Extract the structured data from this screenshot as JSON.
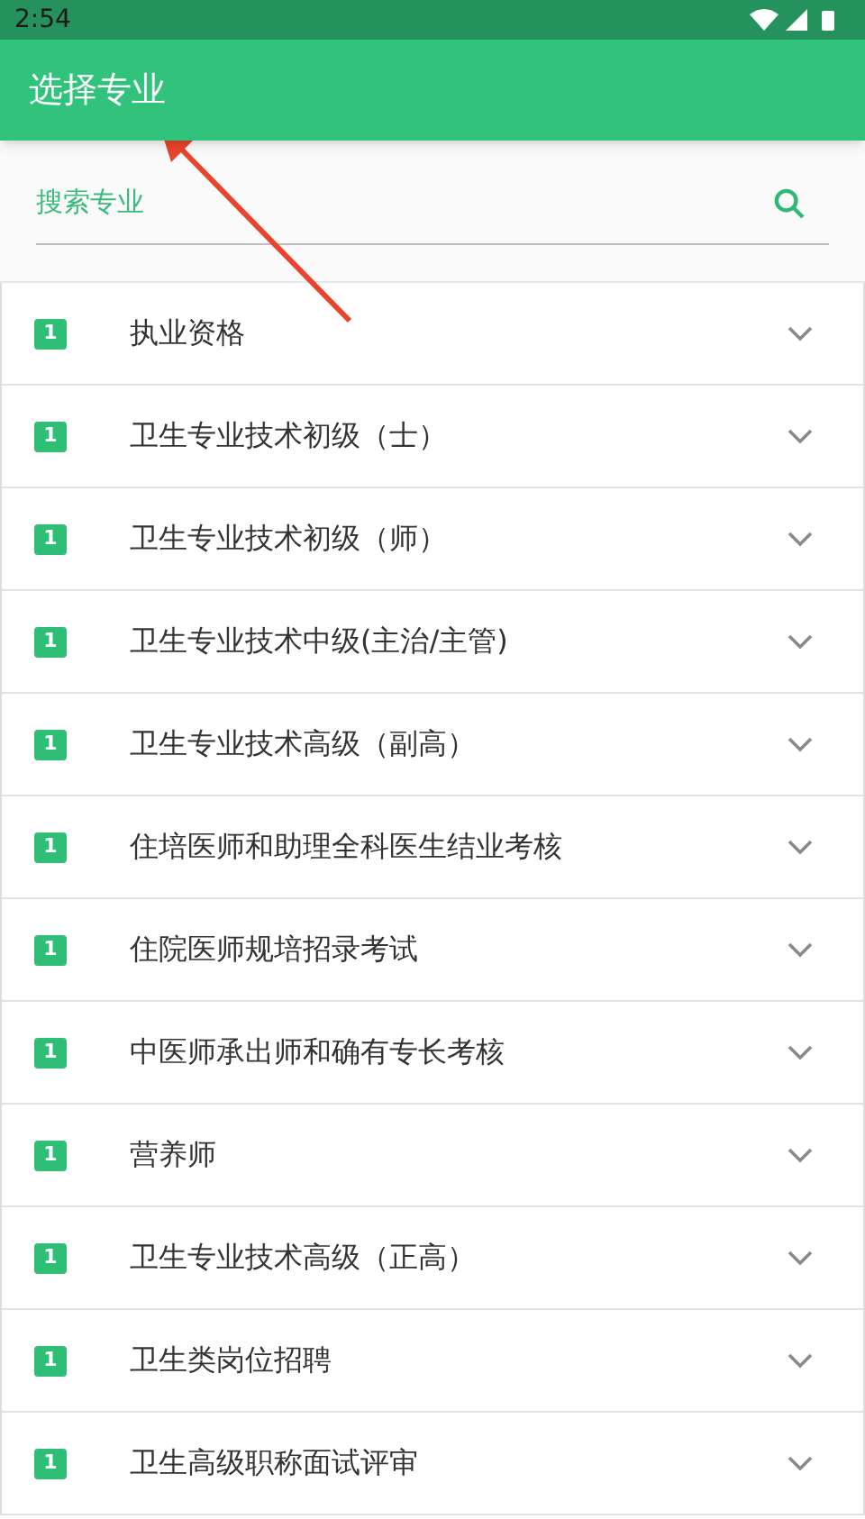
{
  "status_bar": {
    "time": "2:54"
  },
  "app_bar": {
    "title": "选择专业"
  },
  "search": {
    "placeholder": "搜索专业"
  },
  "items": [
    {
      "badge": "1",
      "label": "执业资格",
      "expanded": false
    },
    {
      "badge": "1",
      "label": "卫生专业技术初级（士）",
      "expanded": false
    },
    {
      "badge": "1",
      "label": "卫生专业技术初级（师）",
      "expanded": false
    },
    {
      "badge": "1",
      "label": "卫生专业技术中级(主治/主管)",
      "expanded": false
    },
    {
      "badge": "1",
      "label": "卫生专业技术高级（副高）",
      "expanded": false
    },
    {
      "badge": "1",
      "label": "住培医师和助理全科医生结业考核",
      "expanded": false
    },
    {
      "badge": "1",
      "label": "住院医师规培招录考试",
      "expanded": false
    },
    {
      "badge": "1",
      "label": "中医师承出师和确有专长考核",
      "expanded": false
    },
    {
      "badge": "1",
      "label": "营养师",
      "expanded": false
    },
    {
      "badge": "1",
      "label": "卫生专业技术高级（正高）",
      "expanded": false
    },
    {
      "badge": "1",
      "label": "卫生类岗位招聘",
      "expanded": false
    },
    {
      "badge": "1",
      "label": "卫生高级职称面试评审",
      "expanded": false
    }
  ]
}
